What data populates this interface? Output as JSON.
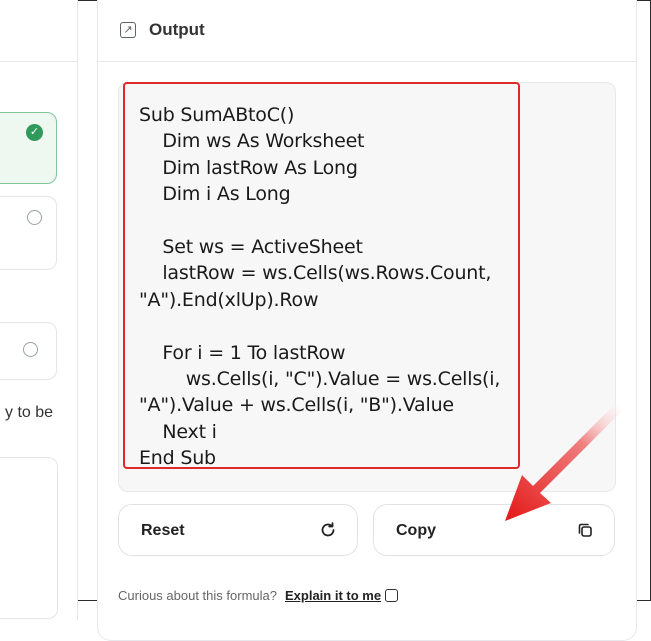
{
  "left_panel": {
    "options": [
      {
        "state": "selected",
        "icon": "check-circle-icon"
      },
      {
        "state": "unselected",
        "icon": "radio-icon"
      },
      {
        "state": "unselected",
        "icon": "radio-icon"
      }
    ],
    "partial_text": "y to be"
  },
  "output": {
    "title": "Output",
    "icon": "arrow-up-right-box-icon",
    "code_lines": [
      "Sub SumABtoC()",
      "    Dim ws As Worksheet",
      "    Dim lastRow As Long",
      "    Dim i As Long",
      "",
      "    Set ws = ActiveSheet",
      "    lastRow = ws.Cells(ws.Rows.Count,",
      "\"A\").End(xlUp).Row",
      "",
      "    For i = 1 To lastRow",
      "        ws.Cells(i, \"C\").Value = ws.Cells(i,",
      "\"A\").Value + ws.Cells(i, \"B\").Value",
      "    Next i",
      "End Sub"
    ]
  },
  "buttons": {
    "reset_label": "Reset",
    "copy_label": "Copy"
  },
  "footer": {
    "curious_text": "Curious about this formula?",
    "explain_link": "Explain it to me"
  },
  "colors": {
    "highlight": "#e02a2a",
    "accent_green": "#2f9a5c"
  }
}
